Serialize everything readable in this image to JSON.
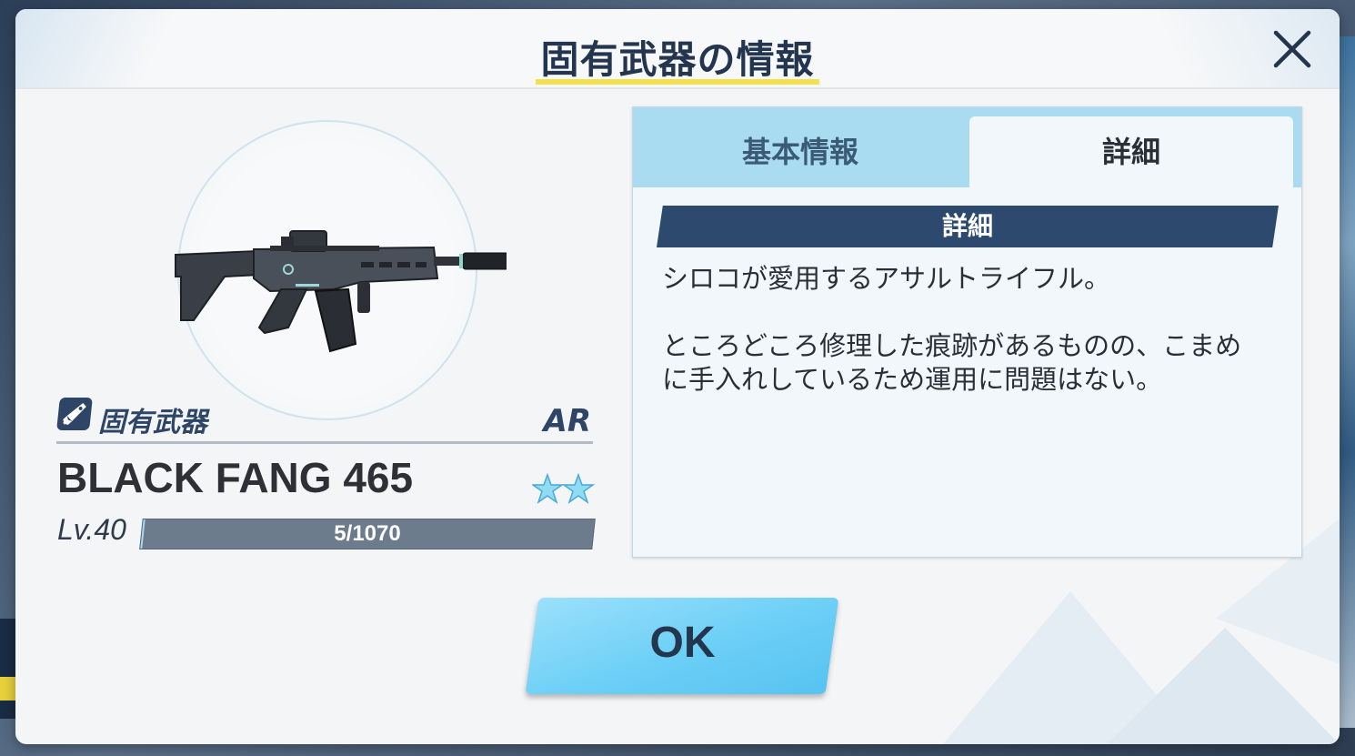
{
  "modal": {
    "title": "固有武器の情報",
    "close_icon": "close-icon"
  },
  "weapon": {
    "category": "固有武器",
    "category_icon": "rocket-icon",
    "class": "AR",
    "name": "BLACK FANG 465",
    "star_count": 2,
    "level_label": "Lv.40",
    "exp_text": "5/1070",
    "exp_fraction": 0.005
  },
  "tabs": {
    "basic_label": "基本情報",
    "detail_label": "詳細",
    "active": "詳細"
  },
  "detail": {
    "section_title": "詳細",
    "description": "シロコが愛用するアサルトライフル。\n\nところどころ修理した痕跡があるものの、こまめ\nに手入れしているため運用に問題はない。"
  },
  "ok_label": "OK",
  "colors": {
    "accent_yellow": "#f3e04f",
    "navy": "#2d4a6e",
    "button_blue": "#6ccff6"
  }
}
